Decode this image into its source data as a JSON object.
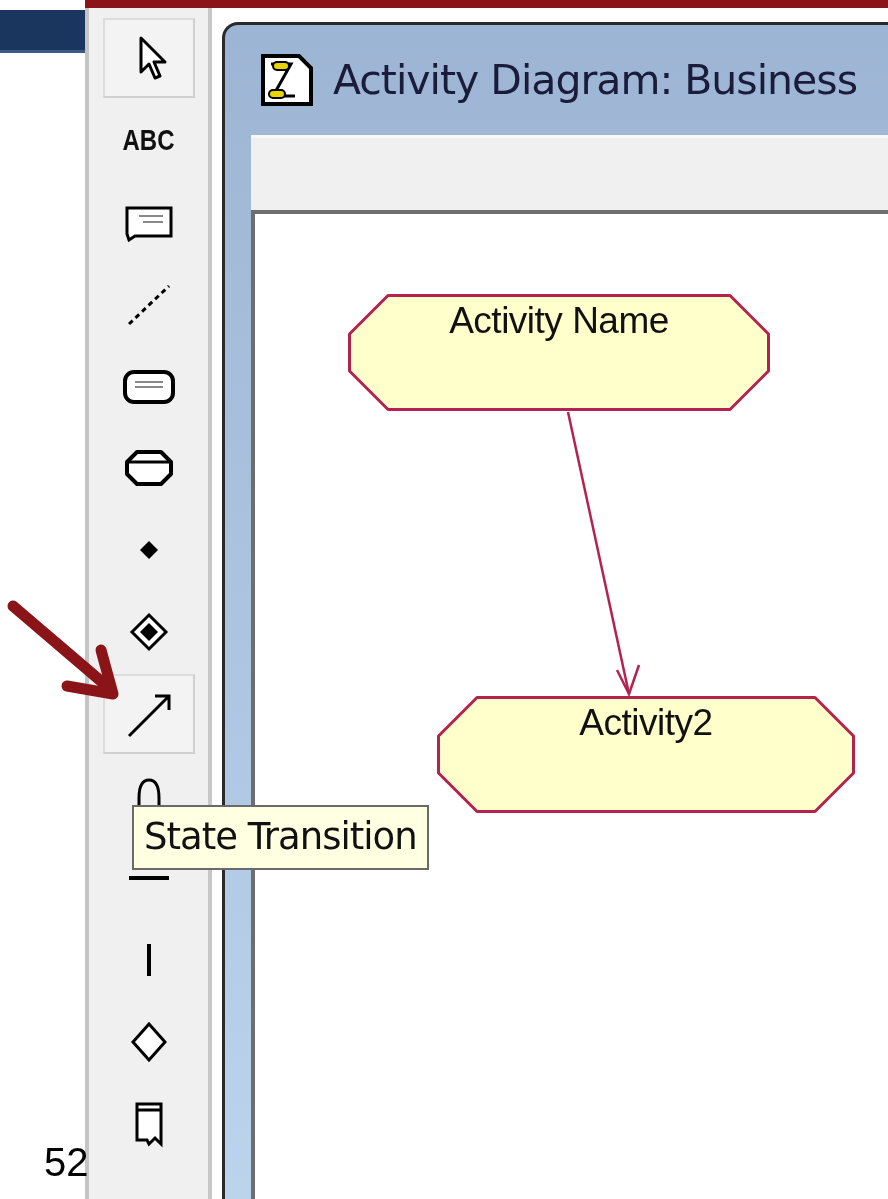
{
  "slide": {
    "page_number": "52"
  },
  "toolbar": {
    "tools": [
      {
        "kind": "pointer",
        "highlighted": true
      },
      {
        "kind": "text",
        "label": "ABC",
        "highlighted": false
      },
      {
        "kind": "note",
        "highlighted": false
      },
      {
        "kind": "anchor",
        "highlighted": false
      },
      {
        "kind": "state",
        "highlighted": false
      },
      {
        "kind": "activity",
        "highlighted": false
      },
      {
        "kind": "start",
        "highlighted": false
      },
      {
        "kind": "end",
        "highlighted": false
      },
      {
        "kind": "transition",
        "highlighted": true
      },
      {
        "kind": "self_transition",
        "highlighted": false
      },
      {
        "kind": "horizontal_sync",
        "highlighted": false
      },
      {
        "kind": "vertical_sync",
        "highlighted": false
      },
      {
        "kind": "decision",
        "highlighted": false
      },
      {
        "kind": "swimlane",
        "highlighted": false
      }
    ]
  },
  "tooltip": {
    "text": "State Transition"
  },
  "window": {
    "title": "Activity Diagram: Business"
  },
  "diagram": {
    "activities": [
      {
        "name": "Activity Name"
      },
      {
        "name": "Activity2"
      }
    ]
  }
}
